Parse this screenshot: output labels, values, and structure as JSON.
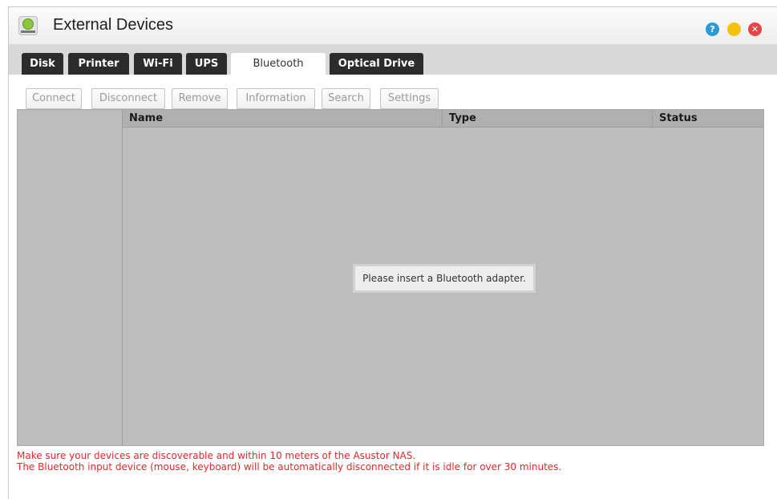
{
  "window": {
    "title": "External Devices",
    "controls": {
      "help": "?",
      "minimize": "",
      "close": "✕"
    }
  },
  "tabs": [
    {
      "label": "Disk",
      "active": false
    },
    {
      "label": "Printer",
      "active": false
    },
    {
      "label": "Wi-Fi",
      "active": false
    },
    {
      "label": "UPS",
      "active": false
    },
    {
      "label": "Bluetooth",
      "active": true
    },
    {
      "label": "Optical Drive",
      "active": false
    }
  ],
  "toolbar": {
    "connect": "Connect",
    "disconnect": "Disconnect",
    "remove": "Remove",
    "information": "Information",
    "search": "Search",
    "settings": "Settings"
  },
  "table": {
    "columns": [
      "Name",
      "Type",
      "Status"
    ],
    "rows": [],
    "empty_message": "Please insert a Bluetooth adapter."
  },
  "notes": {
    "line1": "Make sure your devices are discoverable and within 10 meters of the Asustor NAS.",
    "line2": "The Bluetooth input device (mouse, keyboard) will be automatically disconnected if it is idle for over 30 minutes."
  },
  "colors": {
    "note_text": "#e8262b",
    "help_button": "#2a9bd4",
    "minimize_button": "#f4c20d",
    "close_button": "#e64545",
    "tab_dark": "#2c2c2c"
  },
  "icons": {
    "app": "external-devices-icon",
    "help": "help-icon",
    "minimize": "minimize-icon",
    "close": "close-icon"
  }
}
